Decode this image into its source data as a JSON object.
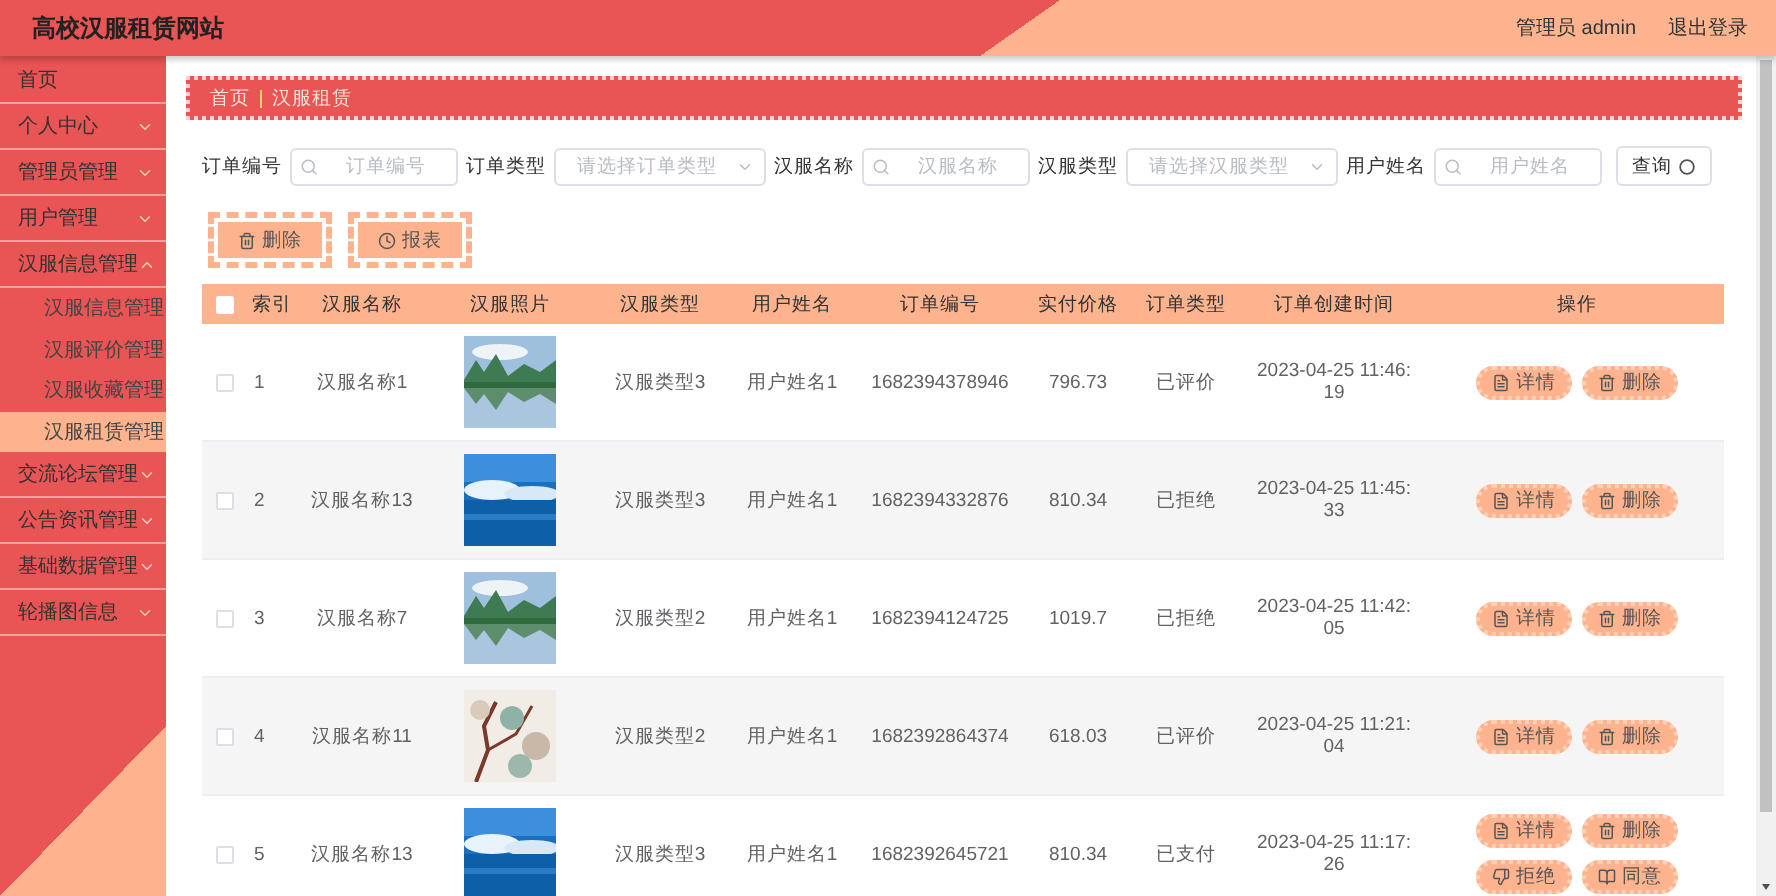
{
  "header": {
    "title": "高校汉服租赁网站",
    "user": "管理员 admin",
    "logout": "退出登录"
  },
  "sidebar": {
    "items": [
      {
        "label": "首页",
        "has_children": false,
        "expanded": false,
        "selected": false
      },
      {
        "label": "个人中心",
        "has_children": true,
        "expanded": false,
        "selected": false
      },
      {
        "label": "管理员管理",
        "has_children": true,
        "expanded": false,
        "selected": false
      },
      {
        "label": "用户管理",
        "has_children": true,
        "expanded": false,
        "selected": false
      },
      {
        "label": "汉服信息管理",
        "has_children": true,
        "expanded": true,
        "selected": false,
        "children": [
          {
            "label": "汉服信息管理",
            "selected": false
          },
          {
            "label": "汉服评价管理",
            "selected": false
          },
          {
            "label": "汉服收藏管理",
            "selected": false
          },
          {
            "label": "汉服租赁管理",
            "selected": true
          }
        ]
      },
      {
        "label": "交流论坛管理",
        "has_children": true,
        "expanded": false,
        "selected": false
      },
      {
        "label": "公告资讯管理",
        "has_children": true,
        "expanded": false,
        "selected": false
      },
      {
        "label": "基础数据管理",
        "has_children": true,
        "expanded": false,
        "selected": false
      },
      {
        "label": "轮播图信息",
        "has_children": true,
        "expanded": false,
        "selected": false
      }
    ]
  },
  "breadcrumb": [
    "首页",
    "汉服租赁"
  ],
  "filters": [
    {
      "kind": "input",
      "label": "订单编号",
      "placeholder": "订单编号"
    },
    {
      "kind": "select",
      "label": "订单类型",
      "placeholder": "请选择订单类型"
    },
    {
      "kind": "input",
      "label": "汉服名称",
      "placeholder": "汉服名称"
    },
    {
      "kind": "select",
      "label": "汉服类型",
      "placeholder": "请选择汉服类型"
    },
    {
      "kind": "input",
      "label": "用户姓名",
      "placeholder": "用户姓名"
    }
  ],
  "search_button": "查询",
  "toolbar": [
    {
      "kind": "delete",
      "label": "删除"
    },
    {
      "kind": "report",
      "label": "报表"
    }
  ],
  "table": {
    "select_all_checked": false,
    "columns": [
      "索引",
      "汉服名称",
      "汉服照片",
      "汉服类型",
      "用户姓名",
      "订单编号",
      "实付价格",
      "订单类型",
      "订单创建时间",
      "操作"
    ],
    "rows": [
      {
        "checked": false,
        "index": "1",
        "name": "汉服名称1",
        "photo": {
          "kind": "picture"
        },
        "type": "汉服类型3",
        "user": "用户姓名1",
        "order_no": "1682394378946",
        "price": "796.73",
        "order_type": "已评价",
        "time": "2023-04-25 11:46:\n19",
        "actions": [
          {
            "kind": "detail",
            "label": "详情"
          },
          {
            "kind": "delete",
            "label": "删除"
          }
        ]
      },
      {
        "checked": false,
        "index": "2",
        "name": "汉服名称13",
        "photo": {
          "kind": "picture"
        },
        "type": "汉服类型3",
        "user": "用户姓名1",
        "order_no": "1682394332876",
        "price": "810.34",
        "order_type": "已拒绝",
        "time": "2023-04-25 11:45:\n33",
        "actions": [
          {
            "kind": "detail",
            "label": "详情"
          },
          {
            "kind": "delete",
            "label": "删除"
          }
        ]
      },
      {
        "checked": false,
        "index": "3",
        "name": "汉服名称7",
        "photo": {
          "kind": "picture"
        },
        "type": "汉服类型2",
        "user": "用户姓名1",
        "order_no": "1682394124725",
        "price": "1019.7",
        "order_type": "已拒绝",
        "time": "2023-04-25 11:42:\n05",
        "actions": [
          {
            "kind": "detail",
            "label": "详情"
          },
          {
            "kind": "delete",
            "label": "删除"
          }
        ]
      },
      {
        "checked": false,
        "index": "4",
        "name": "汉服名称11",
        "photo": {
          "kind": "picture"
        },
        "type": "汉服类型2",
        "user": "用户姓名1",
        "order_no": "1682392864374",
        "price": "618.03",
        "order_type": "已评价",
        "time": "2023-04-25 11:21:\n04",
        "actions": [
          {
            "kind": "detail",
            "label": "详情"
          },
          {
            "kind": "delete",
            "label": "删除"
          }
        ]
      },
      {
        "checked": false,
        "index": "5",
        "name": "汉服名称13",
        "photo": {
          "kind": "picture"
        },
        "type": "汉服类型3",
        "user": "用户姓名1",
        "order_no": "1682392645721",
        "price": "810.34",
        "order_type": "已支付",
        "time": "2023-04-25 11:17:\n26",
        "actions": [
          {
            "kind": "detail",
            "label": "详情"
          },
          {
            "kind": "delete",
            "label": "删除"
          },
          {
            "kind": "reject",
            "label": "拒绝"
          },
          {
            "kind": "accept",
            "label": "同意"
          }
        ]
      }
    ]
  }
}
